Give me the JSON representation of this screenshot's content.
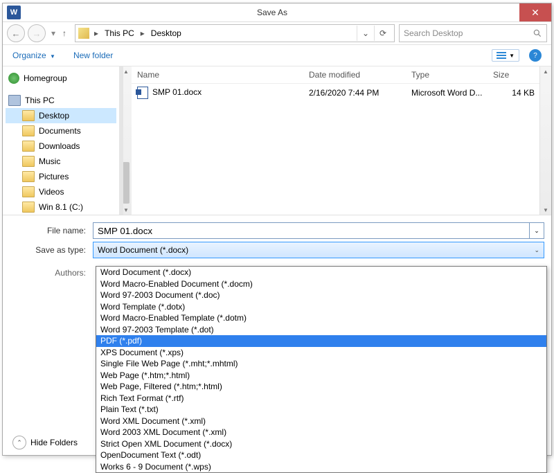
{
  "title": "Save As",
  "nav": {
    "back": "←",
    "fwd": "→",
    "up": "↑",
    "path": [
      "This PC",
      "Desktop"
    ],
    "search_placeholder": "Search Desktop"
  },
  "toolbar": {
    "organize": "Organize",
    "newfolder": "New folder"
  },
  "sidebar": {
    "items": [
      {
        "label": "Homegroup",
        "icon": "homegroup",
        "indent": false,
        "selected": false
      },
      {
        "label": "",
        "icon": "",
        "indent": false,
        "selected": false
      },
      {
        "label": "This PC",
        "icon": "pc",
        "indent": false,
        "selected": false
      },
      {
        "label": "Desktop",
        "icon": "folder",
        "indent": true,
        "selected": true
      },
      {
        "label": "Documents",
        "icon": "folder",
        "indent": true,
        "selected": false
      },
      {
        "label": "Downloads",
        "icon": "folder",
        "indent": true,
        "selected": false
      },
      {
        "label": "Music",
        "icon": "folder",
        "indent": true,
        "selected": false
      },
      {
        "label": "Pictures",
        "icon": "folder",
        "indent": true,
        "selected": false
      },
      {
        "label": "Videos",
        "icon": "folder",
        "indent": true,
        "selected": false
      },
      {
        "label": "Win 8.1 (C:)",
        "icon": "drive",
        "indent": true,
        "selected": false
      }
    ]
  },
  "columns": {
    "name": "Name",
    "date": "Date modified",
    "type": "Type",
    "size": "Size"
  },
  "files": [
    {
      "name": "SMP 01.docx",
      "date": "2/16/2020 7:44 PM",
      "type": "Microsoft Word D...",
      "size": "14 KB"
    }
  ],
  "form": {
    "filename_label": "File name:",
    "filename_value": "SMP 01.docx",
    "savetype_label": "Save as type:",
    "savetype_value": "Word Document (*.docx)",
    "authors_label": "Authors:"
  },
  "hide_folders": "Hide Folders",
  "dropdown": {
    "options": [
      "Word Document (*.docx)",
      "Word Macro-Enabled Document (*.docm)",
      "Word 97-2003 Document (*.doc)",
      "Word Template (*.dotx)",
      "Word Macro-Enabled Template (*.dotm)",
      "Word 97-2003 Template (*.dot)",
      "PDF (*.pdf)",
      "XPS Document (*.xps)",
      "Single File Web Page (*.mht;*.mhtml)",
      "Web Page (*.htm;*.html)",
      "Web Page, Filtered (*.htm;*.html)",
      "Rich Text Format (*.rtf)",
      "Plain Text (*.txt)",
      "Word XML Document (*.xml)",
      "Word 2003 XML Document (*.xml)",
      "Strict Open XML Document (*.docx)",
      "OpenDocument Text (*.odt)",
      "Works 6 - 9 Document (*.wps)"
    ],
    "selected_index": 6
  }
}
